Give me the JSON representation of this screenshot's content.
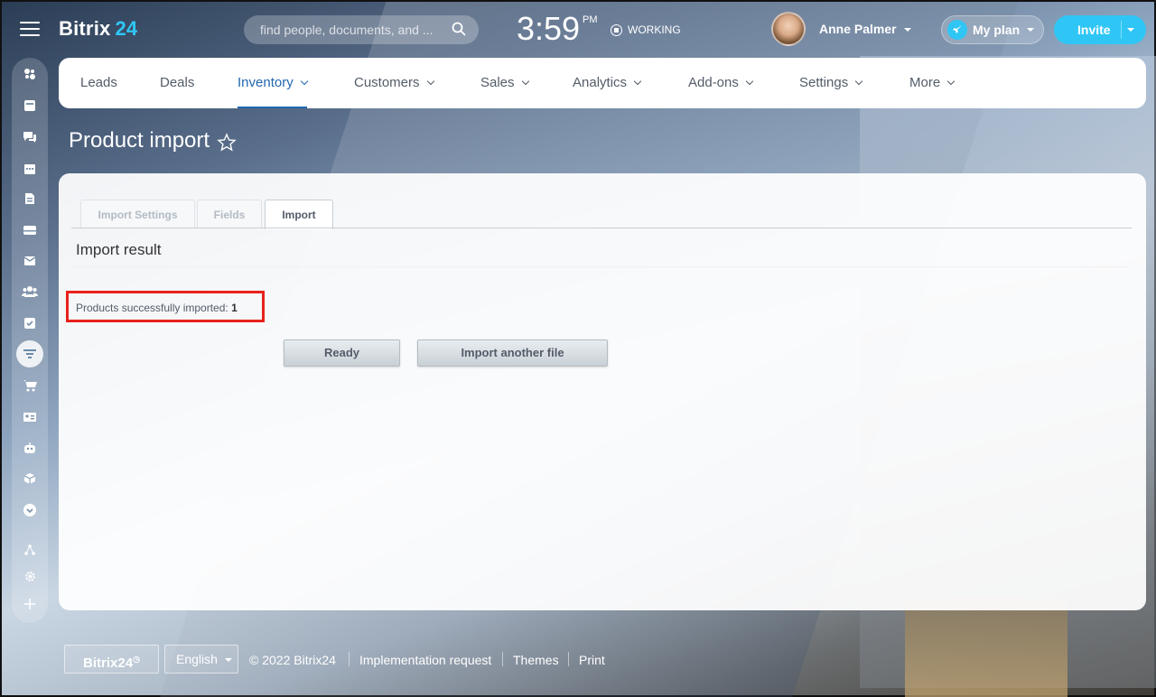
{
  "header": {
    "logo_main": "Bitrix",
    "logo_num": "24",
    "search_placeholder": "find people, documents, and ...",
    "clock_time": "3:59",
    "clock_ampm": "PM",
    "status": "WORKING",
    "user_name": "Anne Palmer",
    "plan_label": "My plan",
    "invite_label": "Invite"
  },
  "nav": {
    "items": [
      {
        "label": "Leads"
      },
      {
        "label": "Deals"
      },
      {
        "label": "Inventory"
      },
      {
        "label": "Customers"
      },
      {
        "label": "Sales"
      },
      {
        "label": "Analytics"
      },
      {
        "label": "Add-ons"
      },
      {
        "label": "Settings"
      },
      {
        "label": "More"
      }
    ]
  },
  "page": {
    "title": "Product import"
  },
  "tabs": [
    {
      "label": "Import Settings"
    },
    {
      "label": "Fields"
    },
    {
      "label": "Import"
    }
  ],
  "result": {
    "title": "Import result",
    "text": "Products successfully imported:",
    "count": "1",
    "ready_label": "Ready",
    "another_label": "Import another file"
  },
  "footer": {
    "logo": "Bitrix24",
    "language": "English",
    "copyright": "© 2022 Bitrix24",
    "impl_request": "Implementation request",
    "themes": "Themes",
    "print": "Print"
  },
  "colors": {
    "accent": "#2fc6f6",
    "active_nav": "#2067b0",
    "highlight": "#e8221c"
  }
}
